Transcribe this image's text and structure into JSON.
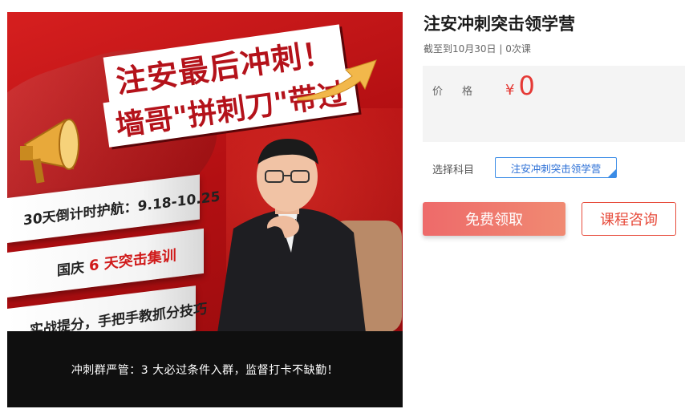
{
  "banner": {
    "headline_line1": "注安最后冲刺！",
    "headline_line2": "墙哥\"拼刺刀\"带过",
    "strip1": "30天倒计时护航：9.18-10.25",
    "strip2_prefix": "国庆",
    "strip2_highlight": "6 天突击集训",
    "strip3": "实战提分，手把手教抓分技巧",
    "footer": "冲刺群严管：3 大必过条件入群，监督打卡不缺勤！"
  },
  "course": {
    "title": "注安冲刺突击领学营",
    "meta": "截至到10月30日 | 0次课",
    "price_label": "价格",
    "currency": "¥",
    "price": "0",
    "subject_label": "选择科目",
    "subject_option": "注安冲刺突击领学营"
  },
  "actions": {
    "free_button": "免费领取",
    "consult_button": "课程咨询"
  },
  "colors": {
    "accent_red": "#e53935",
    "selected_blue": "#3a8be6",
    "banner_red": "#c8161b"
  }
}
